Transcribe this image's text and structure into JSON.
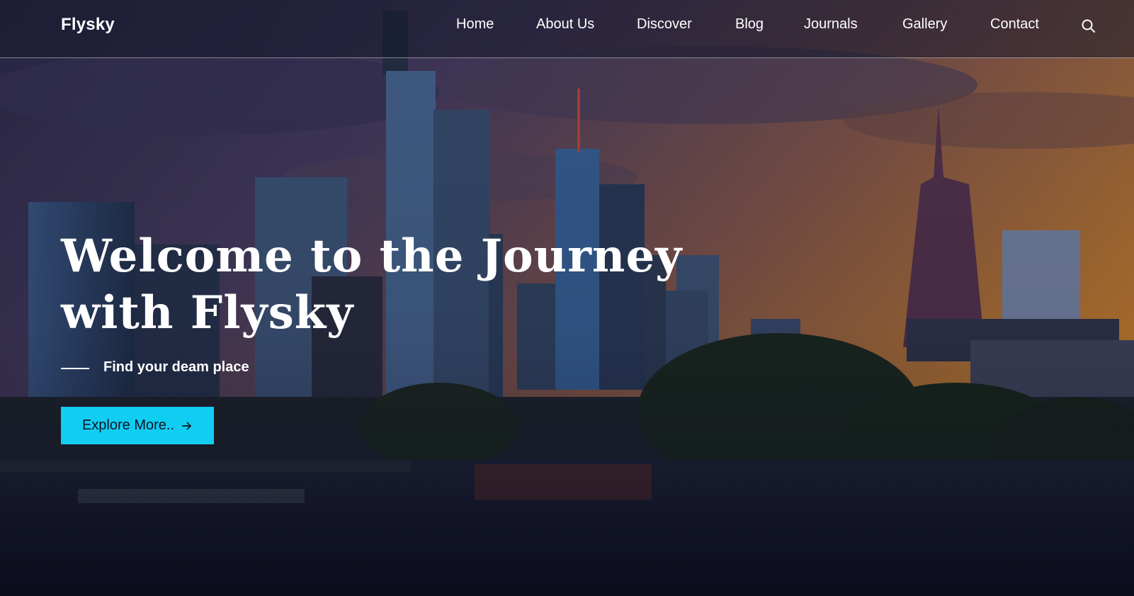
{
  "brand": {
    "name": "Flysky"
  },
  "nav": {
    "items": [
      {
        "label": "Home"
      },
      {
        "label": "About Us"
      },
      {
        "label": "Discover"
      },
      {
        "label": "Blog"
      },
      {
        "label": "Journals"
      },
      {
        "label": "Gallery"
      },
      {
        "label": "Contact"
      }
    ],
    "search_icon": "search-icon"
  },
  "hero": {
    "title_line1": "Welcome to the Journey",
    "title_line2": "with Flysky",
    "tagline": "Find your deam place",
    "cta_label": "Explore More..",
    "cta_icon": "arrow-right-icon",
    "background": "city skyline at sunset with river"
  },
  "colors": {
    "accent": "#11cdf2",
    "nav_text": "#ffffff",
    "overlay": "#16182c"
  }
}
